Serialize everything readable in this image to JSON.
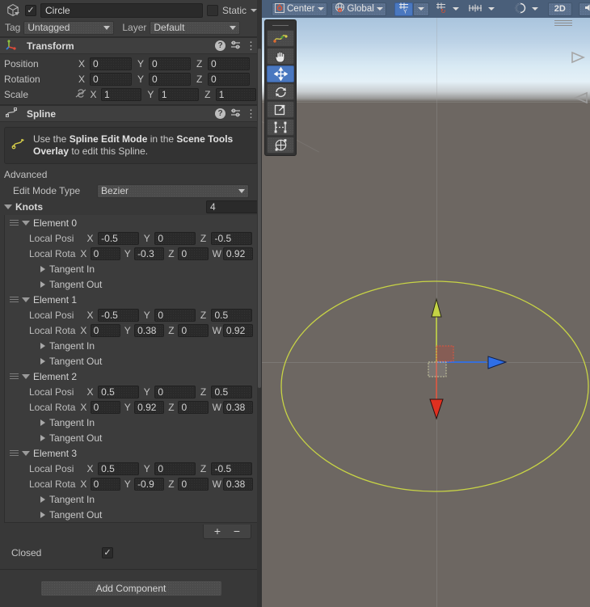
{
  "inspector": {
    "gameobject": {
      "enabled": true,
      "name": "Circle",
      "static_label": "Static",
      "static_checked": false,
      "tag_label": "Tag",
      "tag_value": "Untagged",
      "layer_label": "Layer",
      "layer_value": "Default"
    },
    "transform": {
      "title": "Transform",
      "rows": [
        {
          "label": "Position",
          "x": "0",
          "y": "0",
          "z": "0"
        },
        {
          "label": "Rotation",
          "x": "0",
          "y": "0",
          "z": "0"
        },
        {
          "label": "Scale",
          "x": "1",
          "y": "1",
          "z": "1"
        }
      ],
      "axis_x": "X",
      "axis_y": "Y",
      "axis_z": "Z"
    },
    "spline": {
      "title": "Spline",
      "help_pre": "Use the ",
      "help_b1": "Spline Edit Mode",
      "help_mid": " in the ",
      "help_b2": "Scene Tools Overlay",
      "help_post": " to edit this Spline.",
      "advanced_label": "Advanced",
      "edit_mode_label": "Edit Mode Type",
      "edit_mode_value": "Bezier",
      "knots_label": "Knots",
      "knots_count": "4",
      "pos_label": "Local Posi",
      "rot_label": "Local Rota",
      "axis_x": "X",
      "axis_y": "Y",
      "axis_z": "Z",
      "axis_w": "W",
      "tangent_in_label": "Tangent In",
      "tangent_out_label": "Tangent Out",
      "knots": [
        {
          "name": "Element 0",
          "pos": {
            "x": "-0.5",
            "y": "0",
            "z": "-0.5"
          },
          "rot": {
            "x": "0",
            "y": "-0.3",
            "z": "0",
            "w": "0.92"
          }
        },
        {
          "name": "Element 1",
          "pos": {
            "x": "-0.5",
            "y": "0",
            "z": "0.5"
          },
          "rot": {
            "x": "0",
            "y": "0.38",
            "z": "0",
            "w": "0.92"
          }
        },
        {
          "name": "Element 2",
          "pos": {
            "x": "0.5",
            "y": "0",
            "z": "0.5"
          },
          "rot": {
            "x": "0",
            "y": "0.92",
            "z": "0",
            "w": "0.38"
          }
        },
        {
          "name": "Element 3",
          "pos": {
            "x": "0.5",
            "y": "0",
            "z": "-0.5"
          },
          "rot": {
            "x": "0",
            "y": "-0.9",
            "z": "0",
            "w": "0.38"
          }
        }
      ],
      "add_button": "+",
      "remove_button": "−",
      "closed_label": "Closed",
      "closed_checked": true
    },
    "add_component_label": "Add Component"
  },
  "scene": {
    "toolbar": {
      "pivot_mode": "Center",
      "handle_space": "Global",
      "toggle_2d": "2D"
    },
    "tools": [
      {
        "name": "spline-edit-tool",
        "active": false
      },
      {
        "name": "hand-tool",
        "active": false
      },
      {
        "name": "move-tool",
        "active": true
      },
      {
        "name": "rotate-tool",
        "active": false
      },
      {
        "name": "scale-tool",
        "active": false
      },
      {
        "name": "rect-tool",
        "active": false
      },
      {
        "name": "transform-tool",
        "active": false
      }
    ],
    "colors": {
      "spline": "#c8d445",
      "axis_y": "#c4d445",
      "axis_x": "#2f6fe8",
      "axis_z": "#e03020",
      "selection": "#4a78c0",
      "ground": "#6d6762"
    }
  }
}
